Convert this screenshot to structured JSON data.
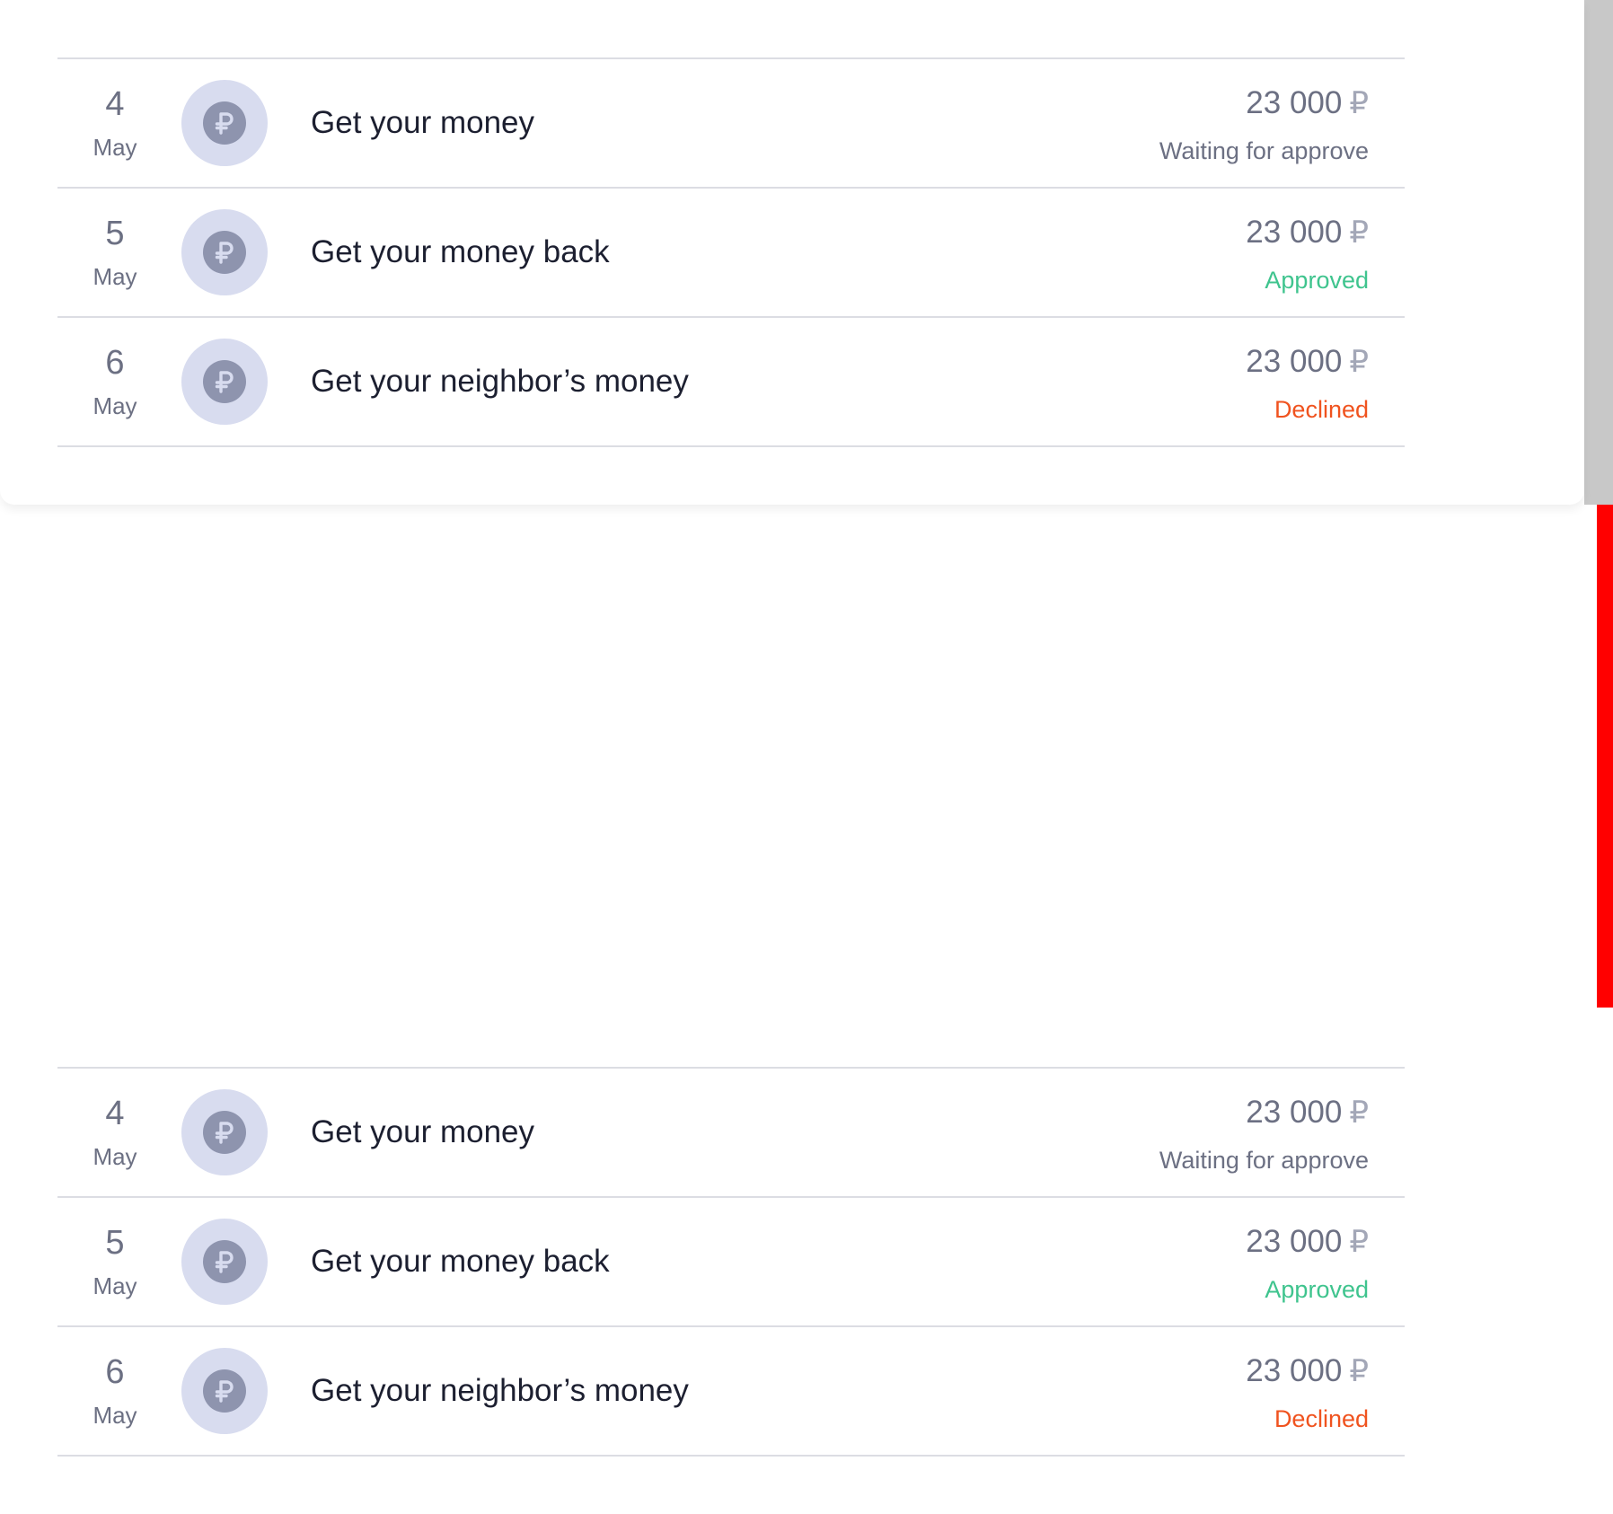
{
  "colors": {
    "waiting": "#6c7083",
    "approved": "#3fc48e",
    "declined": "#f0531f",
    "icon_bg": "#d8dcef",
    "icon_fg": "#8e94ae"
  },
  "icon": "ruble-coin-icon",
  "top_list": {
    "rows": [
      {
        "day": "4",
        "month": "May",
        "title": "Get your money",
        "amount": "23 000",
        "currency": "₽",
        "status": "Waiting for approve",
        "status_type": "waiting"
      },
      {
        "day": "5",
        "month": "May",
        "title": "Get your money back",
        "amount": "23 000",
        "currency": "₽",
        "status": "Approved",
        "status_type": "approved"
      },
      {
        "day": "6",
        "month": "May",
        "title": "Get your neighbor’s money",
        "amount": "23 000",
        "currency": "₽",
        "status": "Declined",
        "status_type": "declined"
      }
    ]
  },
  "bottom_list": {
    "rows": [
      {
        "day": "4",
        "month": "May",
        "title": "Get your money",
        "amount": "23 000",
        "currency": "₽",
        "status": "Waiting for approve",
        "status_type": "waiting"
      },
      {
        "day": "5",
        "month": "May",
        "title": "Get your money back",
        "amount": "23 000",
        "currency": "₽",
        "status": "Approved",
        "status_type": "approved"
      },
      {
        "day": "6",
        "month": "May",
        "title": "Get your neighbor’s money",
        "amount": "23 000",
        "currency": "₽",
        "status": "Declined",
        "status_type": "declined"
      }
    ]
  }
}
